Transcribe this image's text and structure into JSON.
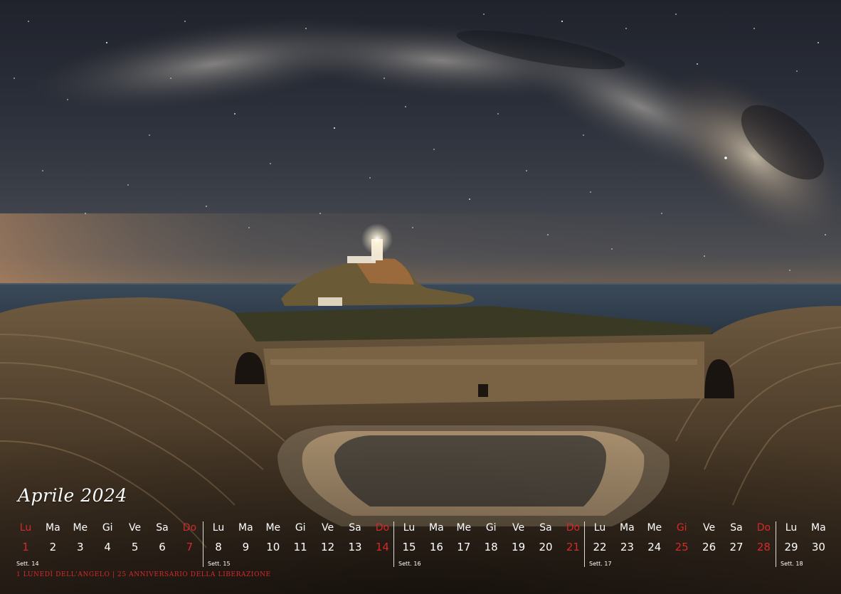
{
  "calendar": {
    "month_title": "Aprile 2024",
    "footnote": "1 Lunedì dell'Angelo | 25 Anniversario della Liberazione",
    "weeks": [
      {
        "label": "Sett. 14",
        "days": [
          {
            "name": "Lu",
            "date": "1",
            "red": true
          },
          {
            "name": "Ma",
            "date": "2",
            "red": false
          },
          {
            "name": "Me",
            "date": "3",
            "red": false
          },
          {
            "name": "Gi",
            "date": "4",
            "red": false
          },
          {
            "name": "Ve",
            "date": "5",
            "red": false
          },
          {
            "name": "Sa",
            "date": "6",
            "red": false
          },
          {
            "name": "Do",
            "date": "7",
            "red": true
          }
        ]
      },
      {
        "label": "Sett. 15",
        "days": [
          {
            "name": "Lu",
            "date": "8",
            "red": false
          },
          {
            "name": "Ma",
            "date": "9",
            "red": false
          },
          {
            "name": "Me",
            "date": "10",
            "red": false
          },
          {
            "name": "Gi",
            "date": "11",
            "red": false
          },
          {
            "name": "Ve",
            "date": "12",
            "red": false
          },
          {
            "name": "Sa",
            "date": "13",
            "red": false
          },
          {
            "name": "Do",
            "date": "14",
            "red": true
          }
        ]
      },
      {
        "label": "Sett. 16",
        "days": [
          {
            "name": "Lu",
            "date": "15",
            "red": false
          },
          {
            "name": "Ma",
            "date": "16",
            "red": false
          },
          {
            "name": "Me",
            "date": "17",
            "red": false
          },
          {
            "name": "Gi",
            "date": "18",
            "red": false
          },
          {
            "name": "Ve",
            "date": "19",
            "red": false
          },
          {
            "name": "Sa",
            "date": "20",
            "red": false
          },
          {
            "name": "Do",
            "date": "21",
            "red": true
          }
        ]
      },
      {
        "label": "Sett. 17",
        "days": [
          {
            "name": "Lu",
            "date": "22",
            "red": false
          },
          {
            "name": "Ma",
            "date": "23",
            "red": false
          },
          {
            "name": "Me",
            "date": "24",
            "red": false
          },
          {
            "name": "Gi",
            "date": "25",
            "red": true
          },
          {
            "name": "Ve",
            "date": "26",
            "red": false
          },
          {
            "name": "Sa",
            "date": "27",
            "red": false
          },
          {
            "name": "Do",
            "date": "28",
            "red": true
          }
        ]
      },
      {
        "label": "Sett. 18",
        "days": [
          {
            "name": "Lu",
            "date": "29",
            "red": false
          },
          {
            "name": "Ma",
            "date": "30",
            "red": false
          }
        ]
      }
    ]
  },
  "colors": {
    "holiday_red": "#d42a2a",
    "text_white": "#ffffff"
  }
}
